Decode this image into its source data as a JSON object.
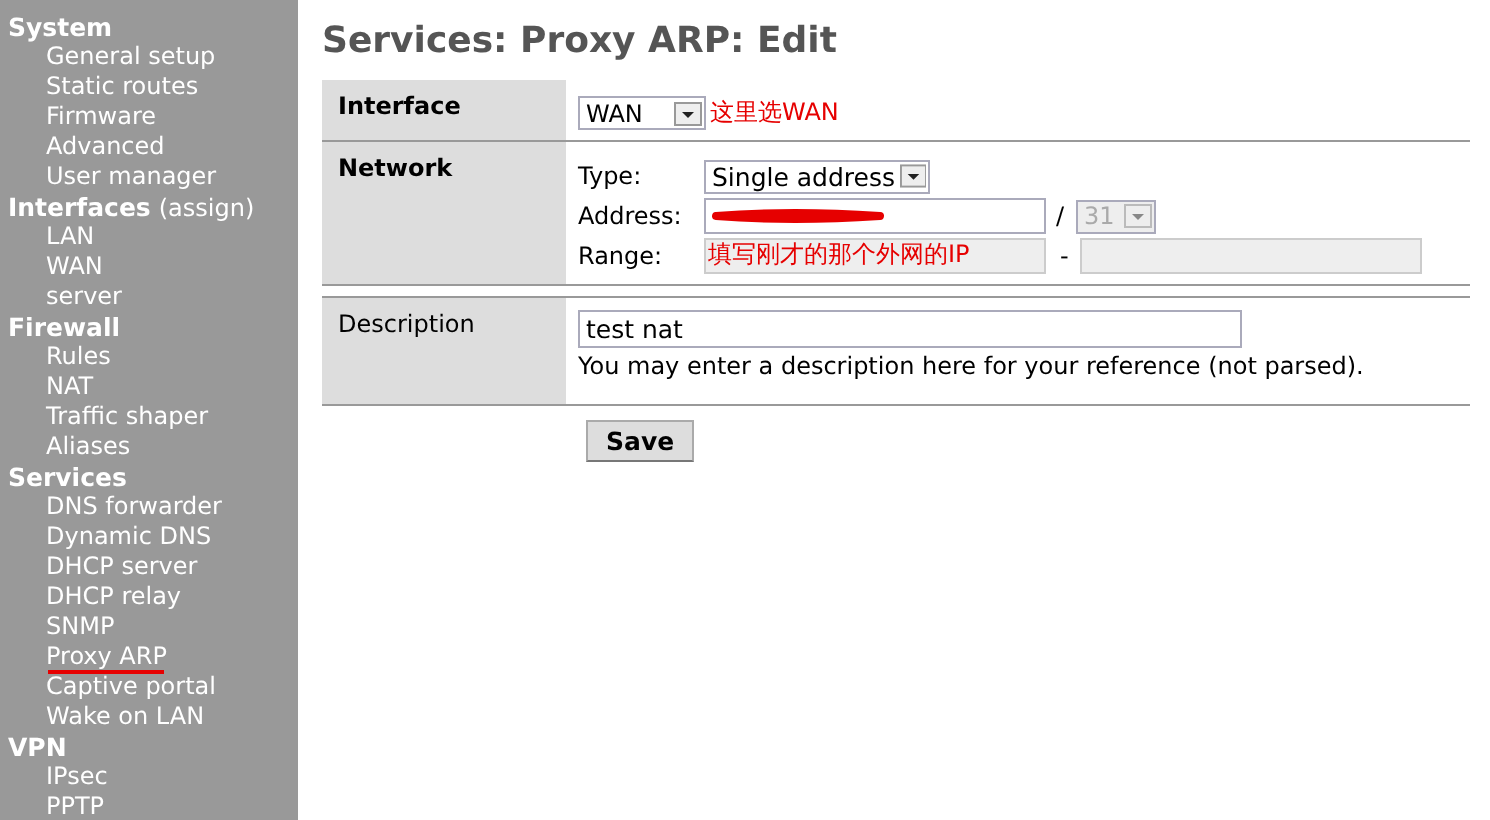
{
  "sidebar": {
    "groups": [
      {
        "title": "System",
        "items": [
          {
            "label": "General setup",
            "marked": false
          },
          {
            "label": "Static routes",
            "marked": false
          },
          {
            "label": "Firmware",
            "marked": false
          },
          {
            "label": "Advanced",
            "marked": false
          },
          {
            "label": "User manager",
            "marked": false
          }
        ]
      },
      {
        "title": "Interfaces",
        "extra": "(assign)",
        "items": [
          {
            "label": "LAN",
            "marked": false
          },
          {
            "label": "WAN",
            "marked": false
          },
          {
            "label": "server",
            "marked": false
          }
        ]
      },
      {
        "title": "Firewall",
        "items": [
          {
            "label": "Rules",
            "marked": false
          },
          {
            "label": "NAT",
            "marked": false
          },
          {
            "label": "Traffic shaper",
            "marked": false
          },
          {
            "label": "Aliases",
            "marked": false
          }
        ]
      },
      {
        "title": "Services",
        "items": [
          {
            "label": "DNS forwarder",
            "marked": false
          },
          {
            "label": "Dynamic DNS",
            "marked": false
          },
          {
            "label": "DHCP server",
            "marked": false
          },
          {
            "label": "DHCP relay",
            "marked": false
          },
          {
            "label": "SNMP",
            "marked": false
          },
          {
            "label": "Proxy ARP",
            "marked": true
          },
          {
            "label": "Captive portal",
            "marked": false
          },
          {
            "label": "Wake on LAN",
            "marked": false
          }
        ]
      },
      {
        "title": "VPN",
        "items": [
          {
            "label": "IPsec",
            "marked": false
          },
          {
            "label": "PPTP",
            "marked": false
          }
        ]
      }
    ]
  },
  "page_title": "Services: Proxy ARP: Edit",
  "form": {
    "interface": {
      "label": "Interface",
      "value": "WAN",
      "note": "这里选WAN"
    },
    "network": {
      "label": "Network",
      "type_label": "Type:",
      "type_value": "Single address",
      "address_label": "Address:",
      "address_redacted": true,
      "mask_separator": "/",
      "mask_value": "31",
      "mask_disabled": true,
      "range_label": "Range:",
      "range_disabled": true,
      "range_separator": "-",
      "range_note": "填写刚才的那个外网的IP"
    },
    "description": {
      "label": "Description",
      "value": "test nat",
      "help": "You may enter a description here for your reference (not parsed)."
    },
    "save": "Save"
  }
}
